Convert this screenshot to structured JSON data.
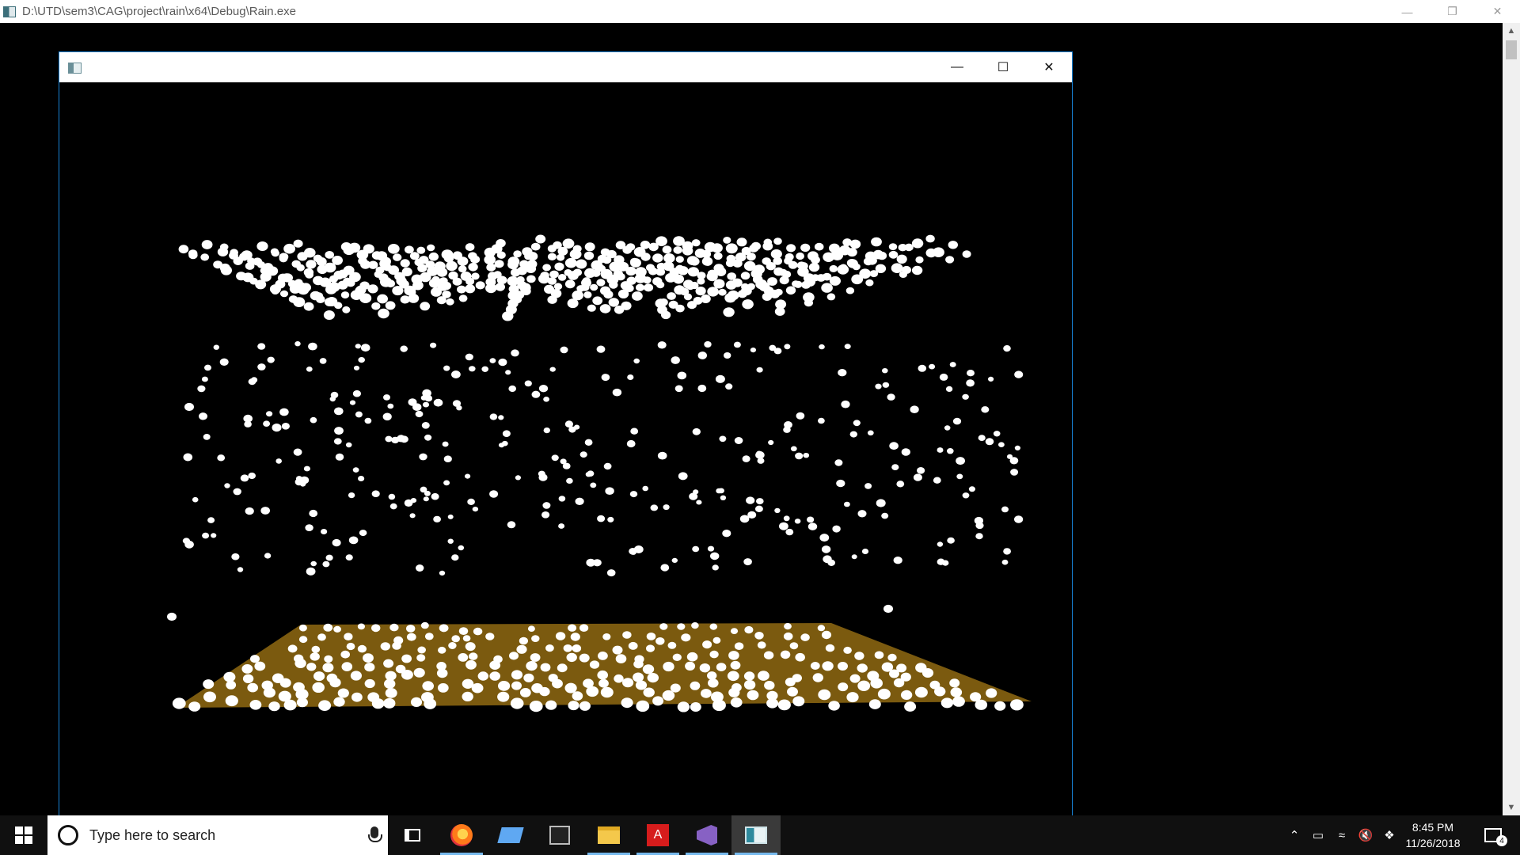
{
  "console": {
    "title": "D:\\UTD\\sem3\\CAG\\project\\rain\\x64\\Debug\\Rain.exe",
    "controls": [
      "minimize",
      "restore",
      "close"
    ]
  },
  "gl_window": {
    "title": "",
    "controls": [
      "minimize",
      "maximize",
      "close"
    ],
    "scene": {
      "background_color": "#000000",
      "ground_color": "#7b5a0f",
      "drop_color": "#ffffff"
    }
  },
  "taskbar": {
    "search_placeholder": "Type here to search",
    "apps": [
      {
        "name": "task-view",
        "icon": "task-view-icon"
      },
      {
        "name": "firefox",
        "icon": "firefox-icon"
      },
      {
        "name": "remote-desktop",
        "icon": "remote-desktop-icon"
      },
      {
        "name": "command-prompt",
        "icon": "command-prompt-icon"
      },
      {
        "name": "file-explorer",
        "icon": "file-explorer-icon"
      },
      {
        "name": "acrobat",
        "icon": "acrobat-icon"
      },
      {
        "name": "visual-studio",
        "icon": "visual-studio-icon"
      },
      {
        "name": "rain-app",
        "icon": "opengl-window-icon"
      }
    ],
    "clock": {
      "time": "8:45 PM",
      "date": "11/26/2018"
    },
    "notifications_count": "4"
  }
}
